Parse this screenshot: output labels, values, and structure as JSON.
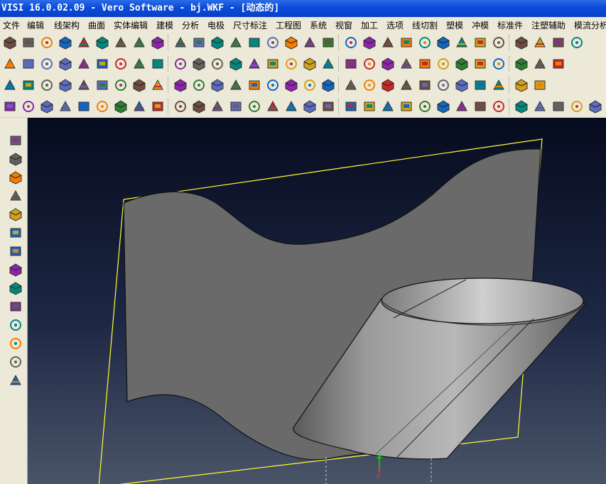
{
  "window": {
    "title": "VISI 16.0.02.09 - Vero Software - bj.WKF - [动态的]"
  },
  "menu": [
    "文件",
    "编辑",
    "线架构",
    "曲面",
    "实体编辑",
    "建模",
    "分析",
    "电极",
    "尺寸标注",
    "工程图",
    "系统",
    "视窗",
    "加工",
    "选项",
    "线切割",
    "塑模",
    "冲模",
    "标准件",
    "注塑辅助",
    "模流分析"
  ],
  "toolbar_rows": [
    {
      "row": 1,
      "icons": [
        "new-file-icon",
        "open-folder-icon",
        "open-recent-icon",
        "save-icon",
        "save-as-icon",
        "import-icon",
        "export-icon",
        "print-icon",
        "refresh-view-icon",
        "view-select-icon",
        "zoom-icon",
        "split-view-icon",
        "cube-front-icon",
        "cube-top-icon",
        "cube-right-icon",
        "cube-iso-icon",
        "cube-shade-icon",
        "cube-wire-icon",
        "cube-edge-icon",
        "cube-hidden-icon",
        "cube-cut-icon",
        "cube-explode-icon",
        "solid-box-icon",
        "solid-cylinder-icon",
        "solid-prism-icon",
        "solid-cone-icon",
        "solid-sphere-icon",
        "solid-torus-icon",
        "solid-wedge-icon",
        "solid-hex-icon",
        "solid-shell-icon"
      ]
    },
    {
      "row": 2,
      "icons": [
        "surface-ruled-icon",
        "surface-sweep-icon",
        "surface-loft-icon",
        "surface-net-icon",
        "surface-offset-icon",
        "surface-fill-icon",
        "surface-color-icon",
        "layer-icon",
        "layer-magenta-icon",
        "layer-stack-icon",
        "layer-filter-icon",
        "face-create-icon",
        "face-trim-icon",
        "face-extend-icon",
        "face-untrim-icon",
        "face-split-icon",
        "face-join-icon",
        "face-blend-icon",
        "face-chamfer-icon",
        "face-shell-icon",
        "face-draft-icon",
        "face-move-icon",
        "face-delete-icon",
        "face-replace-icon",
        "face-thicken-icon",
        "grid-plane-icon",
        "grid-rotate-icon",
        "grid-flip-icon",
        "grid-align-icon",
        "grid-scale-icon"
      ]
    },
    {
      "row": 3,
      "icons": [
        "wire-delete-icon",
        "wire-curve-icon",
        "wire-angle-icon",
        "wire-corner-icon",
        "wire-hatch-icon",
        "wire-trim-icon",
        "wire-split-icon",
        "wire-extend-icon",
        "wire-mirror-icon",
        "arc-tangent-icon",
        "circle-icon",
        "circle-center-icon",
        "circle-3pt-icon",
        "circle-2pt-icon",
        "circle-target-icon",
        "circle-diameter-icon",
        "arc-point-icon",
        "arc-rotate-icon",
        "arc-target-icon",
        "rect-icon",
        "rect-pair-icon",
        "rect-offset-icon",
        "box-3d-icon",
        "rect-note-icon",
        "rect-frame-icon",
        "square-icon",
        "ellipse-icon",
        "crescent-icon",
        "polygon-icon"
      ]
    },
    {
      "row": 4,
      "icons": [
        "dim-linear-icon",
        "dim-angle-icon",
        "dim-baseline-icon",
        "dim-chain-icon",
        "dim-tolerance-icon",
        "dim-list-icon",
        "dim-offset-icon",
        "dim-envelope-icon",
        "dim-profile-icon",
        "dim-datum-icon",
        "text-abc-icon",
        "text-edit-icon",
        "leader-arrow-icon",
        "leader-branch-icon",
        "magnify-icon",
        "target-icon",
        "note-box-icon",
        "weld-symbol-icon",
        "roughness-icon",
        "marker-icon",
        "search-mark-icon",
        "sync-icon",
        "cylinder-small-icon",
        "cylinder-stack-icon",
        "cylinder-plain-icon",
        "cylinder-tall-icon",
        "cylinder-blue-icon",
        "cylinder-plate-icon",
        "cylinder-light-icon",
        "cylinder-gray-icon",
        "cylinder-double-icon",
        "cylinder-dark-icon"
      ]
    }
  ],
  "left_toolbar": [
    "point-select-icon",
    "edge-select-icon",
    "line-select-icon",
    "line-select-alt-icon",
    "face-select-icon",
    "solid-select-icon",
    "body-select-icon",
    "corner-select-icon",
    "rotate-select-icon",
    "grid-select-icon",
    "cube-select-icon",
    "frame-select-icon",
    "undo-arrow-icon",
    "redo-arrow-icon"
  ],
  "colors": {
    "viewport_top": "#060b1e",
    "viewport_bottom": "#4a5468",
    "sheet": "#6a6a6a",
    "outline_yellow": "#ffff33"
  },
  "viewport": {
    "axis_label": "Y"
  }
}
